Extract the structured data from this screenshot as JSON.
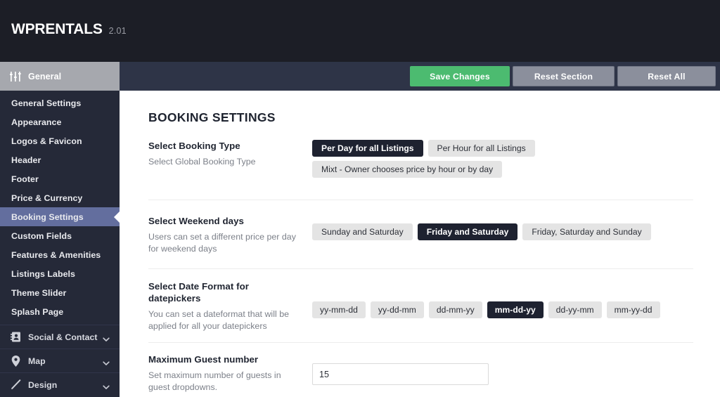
{
  "brand": {
    "name": "WPRENTALS",
    "version": "2.01"
  },
  "sidebar": {
    "group": {
      "label": "General",
      "icon": "sliders-icon"
    },
    "items": [
      {
        "label": "General Settings",
        "active": false
      },
      {
        "label": "Appearance",
        "active": false
      },
      {
        "label": "Logos & Favicon",
        "active": false
      },
      {
        "label": "Header",
        "active": false
      },
      {
        "label": "Footer",
        "active": false
      },
      {
        "label": "Price & Currency",
        "active": false
      },
      {
        "label": "Booking Settings",
        "active": true
      },
      {
        "label": "Custom Fields",
        "active": false
      },
      {
        "label": "Features & Amenities",
        "active": false
      },
      {
        "label": "Listings Labels",
        "active": false
      },
      {
        "label": "Theme Slider",
        "active": false
      },
      {
        "label": "Splash Page",
        "active": false
      }
    ],
    "sections": [
      {
        "label": "Social & Contact",
        "icon": "address-book-icon",
        "chevron": "chevron-down-icon"
      },
      {
        "label": "Map",
        "icon": "map-pin-icon",
        "chevron": "chevron-down-icon"
      },
      {
        "label": "Design",
        "icon": "pencil-icon",
        "chevron": "chevron-down-icon"
      }
    ]
  },
  "toolbar": {
    "save_label": "Save Changes",
    "reset_section_label": "Reset Section",
    "reset_all_label": "Reset All"
  },
  "main": {
    "page_title": "BOOKING SETTINGS",
    "rows": {
      "booking_type": {
        "title": "Select Booking Type",
        "desc": "Select Global Booking Type",
        "options": [
          {
            "label": "Per Day for all Listings",
            "selected": true
          },
          {
            "label": "Per Hour for all Listings",
            "selected": false
          },
          {
            "label": "Mixt - Owner chooses price by hour or by day",
            "selected": false
          }
        ]
      },
      "weekend_days": {
        "title": "Select Weekend days",
        "desc": "Users can set a different price per day for weekend days",
        "options": [
          {
            "label": "Sunday and Saturday",
            "selected": false
          },
          {
            "label": "Friday and Saturday",
            "selected": true
          },
          {
            "label": "Friday, Saturday and Sunday",
            "selected": false
          }
        ]
      },
      "date_format": {
        "title": "Select Date Format for datepickers",
        "desc": "You can set a dateformat that will be applied for all your datepickers",
        "options": [
          {
            "label": "yy-mm-dd",
            "selected": false
          },
          {
            "label": "yy-dd-mm",
            "selected": false
          },
          {
            "label": "dd-mm-yy",
            "selected": false
          },
          {
            "label": "mm-dd-yy",
            "selected": true
          },
          {
            "label": "dd-yy-mm",
            "selected": false
          },
          {
            "label": "mm-yy-dd",
            "selected": false
          }
        ]
      },
      "max_guests": {
        "title": "Maximum Guest number",
        "desc": "Set maximum number of guests in guest dropdowns.",
        "value": "15",
        "placeholder": ""
      }
    }
  },
  "colors": {
    "brandbar": "#1c1e26",
    "sidebar": "#252938",
    "sidebar_active": "#636e9e",
    "sidebar_group_head": "#a6a8ae",
    "toolbar": "#2e3447",
    "save_green": "#4cbb70",
    "reset_gray": "#8b8f9c",
    "option_selected": "#1e2230",
    "option_unselected": "#e4e4e4"
  }
}
